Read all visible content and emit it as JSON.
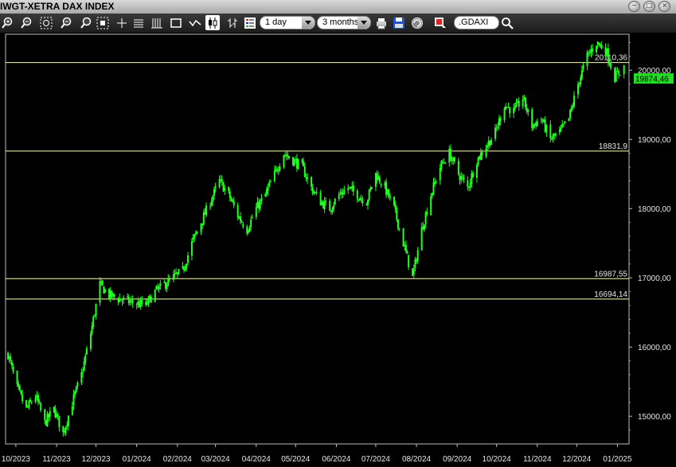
{
  "window": {
    "title": "IWGT-XETRA DAX INDEX"
  },
  "toolbar": {
    "interval_select": "1 day",
    "range_select": "3 months",
    "symbol_input": ".GDAXI",
    "icons": [
      "zoom-in-icon",
      "zoom-out-icon",
      "zoom-in-x-icon",
      "zoom-out-x-icon",
      "fit-icon",
      "crosshair-icon",
      "list-icon",
      "bar-style-icon",
      "line-style-icon",
      "line-chart-icon",
      "candle-style-icon",
      "ohlc-style-icon",
      "legend-icon",
      "print-icon",
      "save-icon",
      "refresh-icon",
      "color-icon",
      "search-icon"
    ]
  },
  "colors": {
    "candle": "#22ff22",
    "hline": "#ffffb0",
    "last_price_bg": "#22dd22",
    "background": "#000000"
  },
  "chart_data": {
    "type": "line",
    "title": "IWGT-XETRA DAX INDEX",
    "x_tick_labels": [
      "10/2023",
      "11/2023",
      "12/2023",
      "01/2024",
      "02/2024",
      "03/2024",
      "04/2024",
      "05/2024",
      "06/2024",
      "07/2024",
      "08/2024",
      "09/2024",
      "10/2024",
      "11/2024",
      "12/2024",
      "01/2025"
    ],
    "y_tick_labels": [
      "15000,00",
      "16000,00",
      "17000,00",
      "18000,00",
      "19000,00",
      "20000,00"
    ],
    "ylim": [
      14600,
      20520
    ],
    "last_price": "19874,46",
    "horizontal_lines": [
      {
        "label": "20110,36",
        "value": 20110.36
      },
      {
        "label": "18831,9",
        "value": 18831.9
      },
      {
        "label": "16987,55",
        "value": 16987.55
      },
      {
        "label": "16694,14",
        "value": 16694.14
      }
    ],
    "series": [
      {
        "x": [
          "2023-09-25",
          "2023-10-02",
          "2023-10-09",
          "2023-10-16",
          "2023-10-23",
          "2023-10-30",
          "2023-11-06",
          "2023-11-13",
          "2023-11-20",
          "2023-11-27",
          "2023-12-04",
          "2023-12-11",
          "2023-12-18",
          "2023-12-27",
          "2024-01-08",
          "2024-01-15",
          "2024-01-22",
          "2024-01-29",
          "2024-02-05",
          "2024-02-12",
          "2024-02-19",
          "2024-02-26",
          "2024-03-04",
          "2024-03-11",
          "2024-03-18",
          "2024-03-25",
          "2024-04-01",
          "2024-04-08",
          "2024-04-15",
          "2024-04-22",
          "2024-04-29",
          "2024-05-06",
          "2024-05-13",
          "2024-05-20",
          "2024-05-27",
          "2024-06-03",
          "2024-06-10",
          "2024-06-17",
          "2024-06-24",
          "2024-07-01",
          "2024-07-08",
          "2024-07-15",
          "2024-07-22",
          "2024-07-29",
          "2024-08-05",
          "2024-08-12",
          "2024-08-19",
          "2024-08-26",
          "2024-09-02",
          "2024-09-09",
          "2024-09-16",
          "2024-09-23",
          "2024-09-30",
          "2024-10-07",
          "2024-10-14",
          "2024-10-21",
          "2024-10-28",
          "2024-11-04",
          "2024-11-11",
          "2024-11-18",
          "2024-11-25",
          "2024-12-02",
          "2024-12-09",
          "2024-12-16",
          "2024-12-23",
          "2024-12-30",
          "2025-01-06"
        ],
        "values": [
          15900,
          15400,
          15100,
          15300,
          14900,
          15100,
          14750,
          15200,
          15600,
          16200,
          16900,
          16750,
          16700,
          16650,
          16600,
          16800,
          16900,
          17000,
          17100,
          17500,
          17800,
          18100,
          18400,
          18200,
          17900,
          17700,
          18000,
          18200,
          18500,
          18800,
          18700,
          18600,
          18300,
          18100,
          18000,
          18200,
          18300,
          18200,
          18100,
          18500,
          18300,
          18000,
          17500,
          17000,
          17700,
          18200,
          18600,
          18800,
          18500,
          18300,
          18700,
          18900,
          19100,
          19500,
          19400,
          19600,
          19200,
          19300,
          19000,
          19100,
          19300,
          19800,
          20200,
          20400,
          20300,
          19900,
          20050
        ]
      }
    ]
  }
}
